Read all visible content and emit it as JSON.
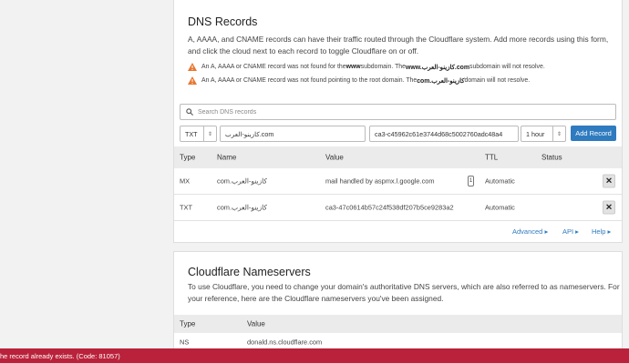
{
  "dns": {
    "title": "DNS Records",
    "description": "A, AAAA, and CNAME records can have their traffic routed through the Cloudflare system. Add more records using this form, and click the cloud next to each record to toggle Cloudflare on or off.",
    "warnings": [
      {
        "pre": "An A, AAAA or CNAME record was not found for the ",
        "b1": "www",
        "mid": " subdomain. The ",
        "b2": "www.كازينو-العرب.com",
        "post": " subdomain will not resolve."
      },
      {
        "pre": "An A, AAAA or CNAME record was not found pointing to the root domain. The ",
        "b1": "كازينو-العرب.com",
        "mid": " domain will not resolve.",
        "b2": "",
        "post": ""
      }
    ],
    "search_placeholder": "Search DNS records",
    "form": {
      "type_value": "TXT",
      "name_value": "كازينو-العرب.com",
      "content_value": "ca3-c45962c61e3744d68c5002760adc48a4",
      "ttl_value": "1 hour",
      "add_label": "Add Record"
    },
    "columns": [
      "Type",
      "Name",
      "Value",
      "TTL",
      "Status"
    ],
    "rows": [
      {
        "type": "MX",
        "name": "كازينو-العرب.com",
        "value": "mail handled by aspmx.l.google.com",
        "priority": "1",
        "ttl": "Automatic"
      },
      {
        "type": "TXT",
        "name": "كازينو-العرب.com",
        "value": "ca3-47c0614b57c24f538df207b5ce9283a2",
        "ttl": "Automatic"
      }
    ],
    "links": {
      "advanced": "Advanced ▸",
      "api": "API ▸",
      "help": "Help ▸"
    }
  },
  "ns": {
    "title": "Cloudflare Nameservers",
    "description": "To use Cloudflare, you need to change your domain's authoritative DNS servers, which are also referred to as nameservers. For your reference, here are the Cloudflare nameservers you've been assigned.",
    "columns": [
      "Type",
      "Value"
    ],
    "rows": [
      {
        "type": "NS",
        "value": "donald.ns.cloudflare.com"
      }
    ]
  },
  "toast": {
    "message": "he record already exists. (Code: 81057)"
  },
  "colors": {
    "accent": "#2f7bbf",
    "error": "#b9223a",
    "warning": "#e8772e"
  }
}
